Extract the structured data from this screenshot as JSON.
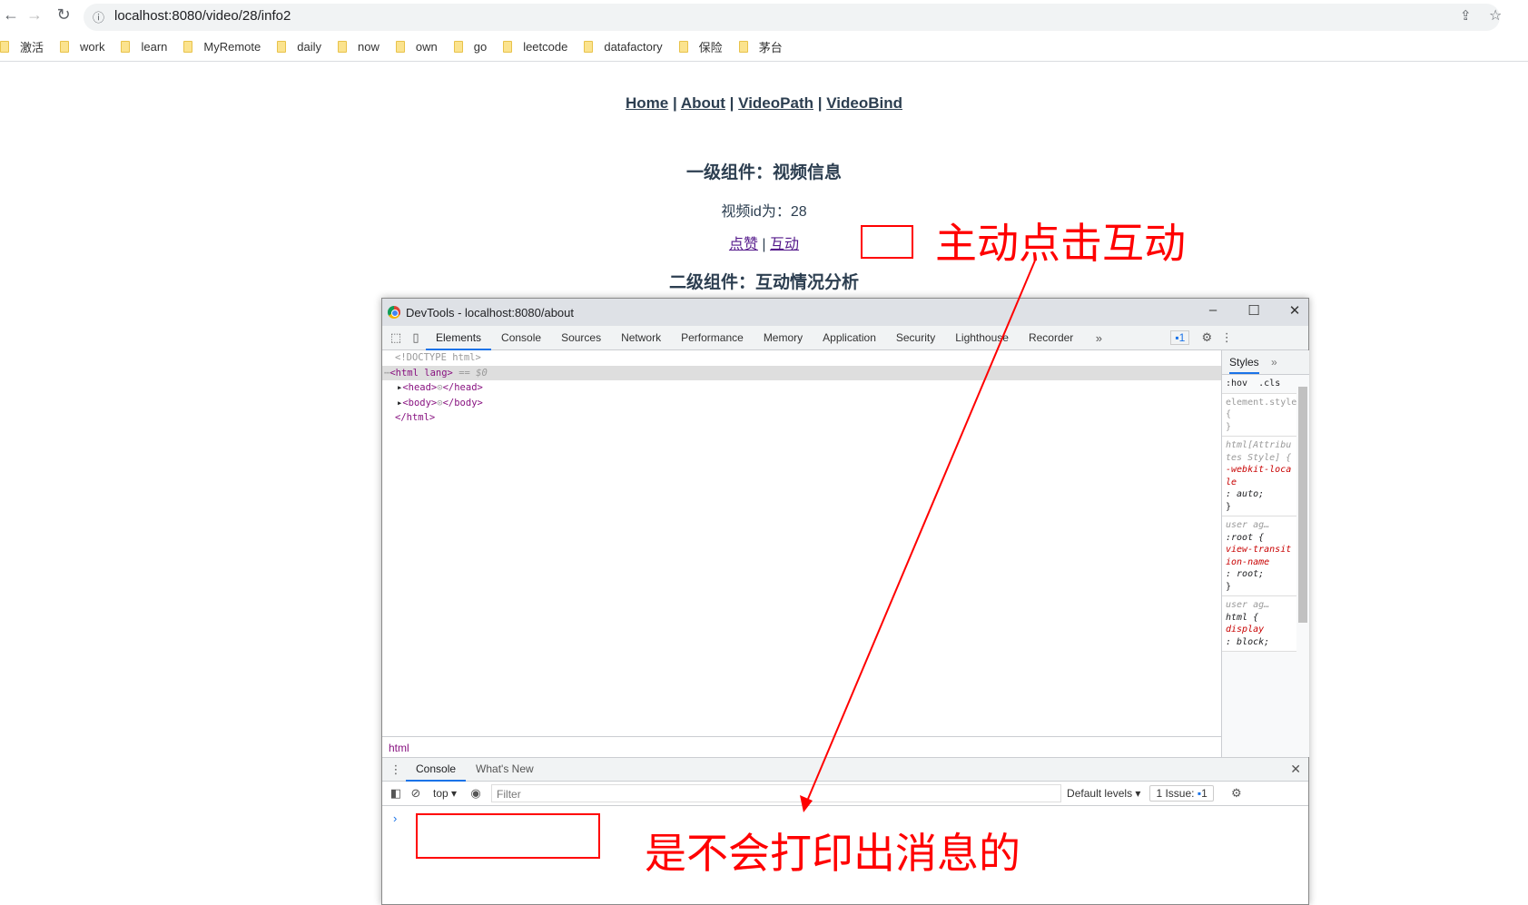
{
  "browser": {
    "url": "localhost:8080/video/28/info2",
    "bookmarks": [
      "激活",
      "work",
      "learn",
      "MyRemote",
      "daily",
      "now",
      "own",
      "go",
      "leetcode",
      "datafactory",
      "保险",
      "茅台"
    ]
  },
  "page": {
    "nav": [
      "Home",
      "About",
      "VideoPath",
      "VideoBind"
    ],
    "sep": "|",
    "h1": "一级组件：视频信息",
    "video_id": "视频id为：28",
    "like": "点赞",
    "interact": "互动",
    "h2": "二级组件：互动情况分析"
  },
  "annotations": {
    "top": "主动点击互动",
    "bottom": "是不会打印出消息的",
    "color": "#ff0000"
  },
  "devtools": {
    "title": "DevTools - localhost:8080/about",
    "tabs": [
      "Elements",
      "Console",
      "Sources",
      "Network",
      "Performance",
      "Memory",
      "Application",
      "Security",
      "Lighthouse",
      "Recorder"
    ],
    "issues_badge": "1",
    "dom": {
      "doctype": "<!DOCTYPE html>",
      "html_open": "<html lang>",
      "html_sel": " == $0",
      "head": "<head>",
      "head_close": "</head>",
      "body": "<body>",
      "body_close": "</body>",
      "html_close": "</html>"
    },
    "styles": {
      "tab": "Styles",
      "hov": ":hov",
      "cls": ".cls",
      "r1": "element.style {",
      "r2sel": "html[Attributes Style] {",
      "r2prop": "-webkit-locale",
      "r2val": ": auto;",
      "ua": "user ag…",
      "r3sel": ":root {",
      "r3prop": "view-transition-name",
      "r3val": ": root;",
      "r4sel": "html {",
      "r4prop": "display",
      "r4val": ": block;",
      "close": "}"
    },
    "breadcrumb": "html",
    "drawer_tabs": [
      "Console",
      "What's New"
    ],
    "console": {
      "context": "top",
      "filter_placeholder": "Filter",
      "levels": "Default levels",
      "issues": "1 Issue:",
      "issues_count": "1",
      "prompt": "›"
    }
  }
}
